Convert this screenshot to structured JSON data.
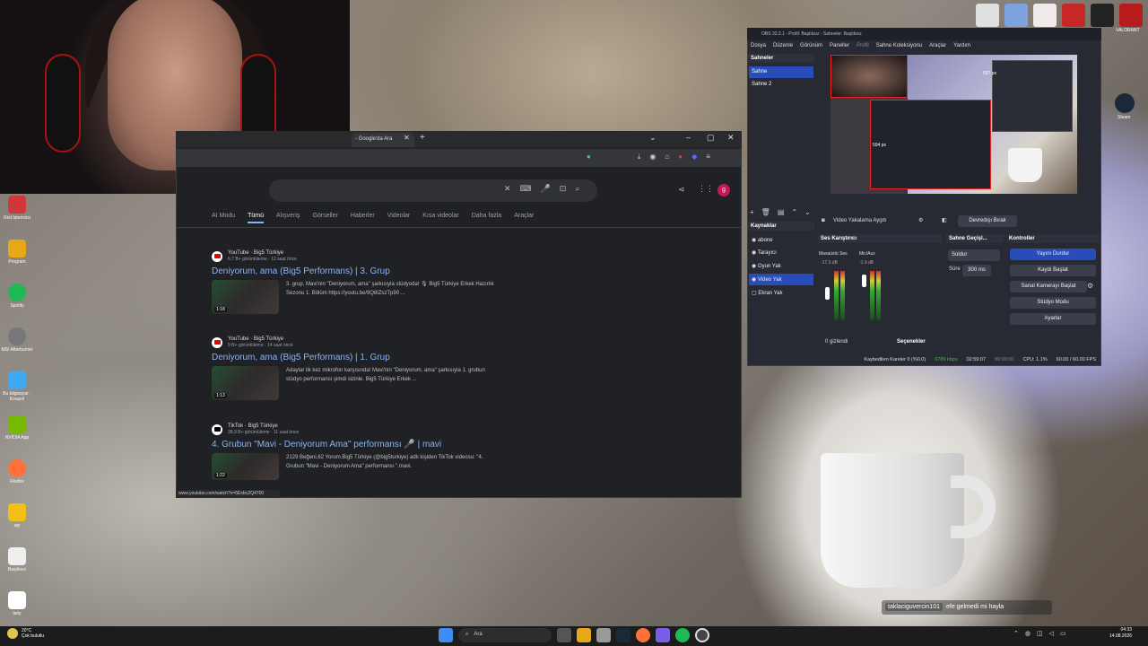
{
  "colors": {
    "accent": "#284cb8",
    "link": "#8ab4f8",
    "brand_red": "#e00000"
  },
  "webcam": {
    "icon": "webcam-overlay"
  },
  "desktop_icons": [
    {
      "label": "Riot Istemcisi",
      "color": "#d13639"
    },
    {
      "label": "Program",
      "color": "#e6a817"
    },
    {
      "label": "Spotify",
      "color": "#1db954"
    },
    {
      "label": "MSI Afterburner",
      "color": "#777777"
    },
    {
      "label": "Bu bilgisayar - Kısayol",
      "color": "#3fa9f5"
    },
    {
      "label": "NVIDIA App",
      "color": "#76b900"
    },
    {
      "label": "Firefox",
      "color": "#ff7139"
    },
    {
      "label": "wp",
      "color": "#f2c012"
    },
    {
      "label": "Başlıksız",
      "color": "#eeeeee"
    },
    {
      "label": "lady",
      "color": "#ffffff"
    }
  ],
  "steam_icon": {
    "label": "Steam"
  },
  "tray_top": {
    "valorant_label": "VALORANT"
  },
  "browser": {
    "tab_label": "- Google'da Ara",
    "tabs_nav": [
      "AI Modu",
      "Tümü",
      "Alışveriş",
      "Görseller",
      "Haberler",
      "Videolar",
      "Kısa videolar",
      "Daha fazla",
      "Araçlar"
    ],
    "profile_letter": "g",
    "results": [
      {
        "site": "YouTube · Big5 Türkiye",
        "meta": "6,7 B+ görüntüleme · 12 saat önce",
        "title": "Deniyorum, ama (Big5 Performans) | 3. Grup",
        "snippet": "3. grup, Mavi'nin \"Deniyorum, ama\" şarkısıyla stüdyoda! 🎙 Big5 Türkiye Erkek Hazırlık Sezonu 1. Bölüm https://youtu.be/9Q8lZszTp90 ...",
        "duration": "1:18",
        "logo": "youtube"
      },
      {
        "site": "YouTube · Big5 Türkiye",
        "meta": "9 B+ görüntüleme · 14 saat önce",
        "title": "Deniyorum, ama (Big5 Performans) | 1. Grup",
        "snippet": "Adaylar ilk kez mikrofon karşısında! Mavi'nin \"Deniyorum, ama\" şarkısıyla 1. grubun stüdyo performansı şimdi sizinle. Big5 Türkiye Erkek ...",
        "duration": "1:13",
        "logo": "youtube"
      },
      {
        "site": "TikTok · Big5 Türkiye",
        "meta": "38,9 B+ görüntüleme · 11 saat önce",
        "title": "4. Grubun \"Mavi - Deniyorum Ama\" performansı 🎤 | mavi",
        "snippet": "2129 Beğeni,62 Yorum.Big5 Türkiye (@big5turkiye) adlı kişiden TikTok videosu: \"4. Grubun \"Mavi - Deniyorum Ama\" performansı \".mavi.",
        "duration": "1:22",
        "logo": "tiktok"
      }
    ],
    "status_url": "www.youtube.com/watch?v=5ExbcZQ4700"
  },
  "obs": {
    "title": "OBS 32.2.1 - Profil: Başlıksız - Sahneler: Başlıksız",
    "menu": [
      "Dosya",
      "Düzenle",
      "Görünüm",
      "Paneller",
      "Profil",
      "Sahne Koleksiyonu",
      "Araçlar",
      "Yardım"
    ],
    "scenes_header": "Sahneler",
    "scenes": [
      "Sahne",
      "Sahne 2"
    ],
    "preview_label_1": "697 px",
    "preview_label_2": "504 px",
    "source_bar_label": "Video Yakalama Aygıtı",
    "deactivate_label": "Devredışı Bırak",
    "sources_header": "Kaynaklar",
    "sources": [
      "abone",
      "Tarayıcı",
      "Oyun Yak",
      "Video Yak",
      "Ekran Yak"
    ],
    "mixer_header": "Ses Karıştırıcı",
    "mixer_channels": [
      "Masaüstü Ses",
      "Mic/Aux"
    ],
    "mixer_db": [
      "-17.3 dB",
      "-1.9 dB"
    ],
    "transitions_header": "Sahne Geçişl...",
    "transition_value": "Soldur",
    "duration_label": "Süre",
    "duration_value": "300 ms",
    "controls_header": "Kontroller",
    "controls": [
      "Yayını Durdur",
      "Kaydı Başlat",
      "Sanal Kamerayı Başlat",
      "Stüdyo Modu",
      "Ayarlar"
    ],
    "hidden_label": "0 gizlendi",
    "options_label": "Seçenekler",
    "status": {
      "dropped": "Kaybedilen Kareler 0 (%0.0)",
      "bitrate": "6789 kbps",
      "stream_time": "02:59:07",
      "rec_time": "00:00:00",
      "cpu": "CPU: 1.1%",
      "fps": "60.00 / 60.00 FPS"
    }
  },
  "chat": {
    "user": "taklaciguvercin101",
    "message": "efe gelmedi mi hayla"
  },
  "taskbar": {
    "weather_temp": "20°C",
    "weather_desc": "Çok bulutlu",
    "search_placeholder": "Ara",
    "time": "04:33",
    "date": "14.08.2026"
  }
}
